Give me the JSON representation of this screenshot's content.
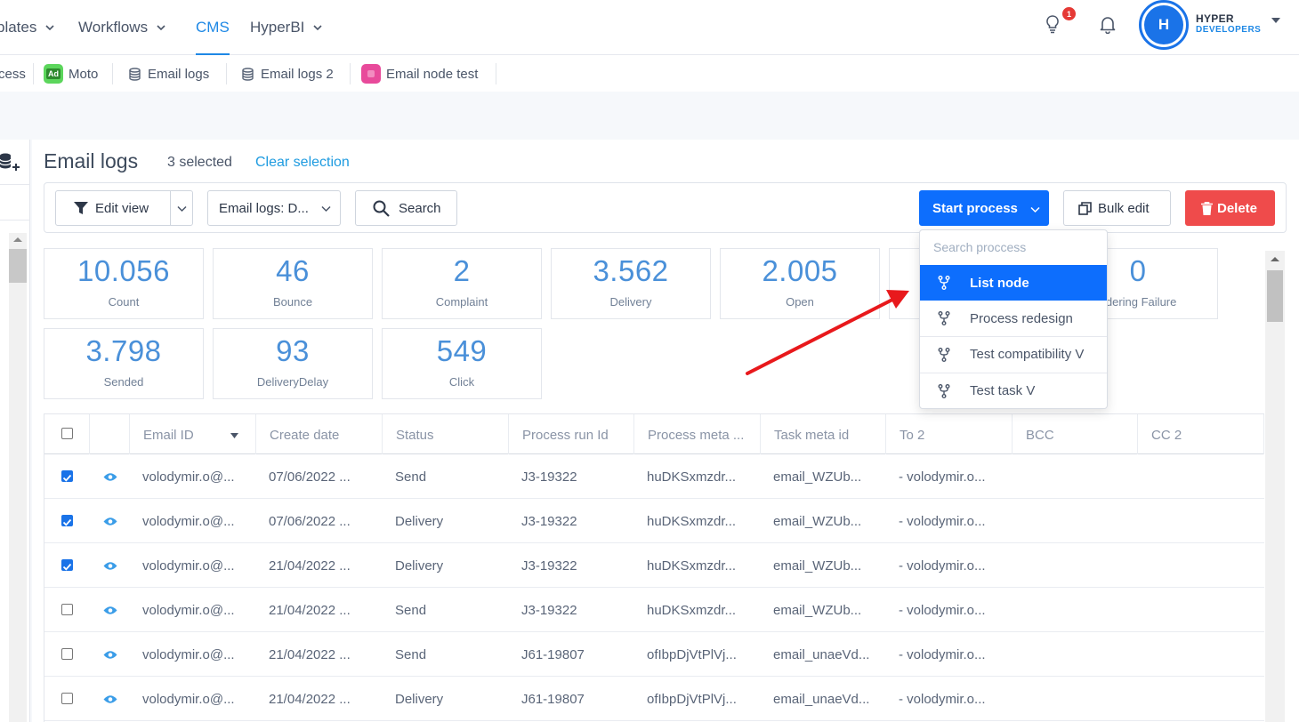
{
  "nav": {
    "items": [
      {
        "label": "plates",
        "has_caret": true
      },
      {
        "label": "Workflows",
        "has_caret": true
      },
      {
        "label": "CMS",
        "has_caret": false,
        "active": true
      },
      {
        "label": "HyperBI",
        "has_caret": true
      }
    ],
    "notification_count": "1",
    "user": {
      "initial": "H",
      "name": "HYPER",
      "org": "DEVELOPERS"
    }
  },
  "tabs": [
    {
      "label": "cess"
    },
    {
      "label": "Moto",
      "badge": "Ad",
      "badge_color": "#5cd65c"
    },
    {
      "label": "Email logs",
      "icon": "database-icon"
    },
    {
      "label": "Email logs 2",
      "icon": "database-icon"
    },
    {
      "label": "Email node test",
      "badge_color": "#e84a9b"
    }
  ],
  "page": {
    "title": "Email logs",
    "selected": "3 selected",
    "clear": "Clear selection"
  },
  "toolbar": {
    "edit_view": "Edit view",
    "view_select": "Email logs: D...",
    "search": "Search",
    "start_process": "Start process",
    "bulk_edit": "Bulk edit",
    "delete": "Delete"
  },
  "stats": [
    {
      "value": "10.056",
      "label": "Count"
    },
    {
      "value": "46",
      "label": "Bounce"
    },
    {
      "value": "2",
      "label": "Complaint"
    },
    {
      "value": "3.562",
      "label": "Delivery"
    },
    {
      "value": "2.005",
      "label": "Open"
    },
    {
      "value": "",
      "label": ""
    },
    {
      "value": "0",
      "label": "ndering Failure"
    },
    {
      "value": "3.798",
      "label": "Sended"
    },
    {
      "value": "93",
      "label": "DeliveryDelay"
    },
    {
      "value": "549",
      "label": "Click"
    }
  ],
  "dropdown": {
    "search_placeholder": "Search proccess",
    "items": [
      {
        "label": "List node",
        "active": true
      },
      {
        "label": "Process redesign"
      },
      {
        "label": "Test compatibility V"
      },
      {
        "label": "Test task V"
      }
    ]
  },
  "table": {
    "columns": [
      "Email ID",
      "Create date",
      "Status",
      "Process run Id",
      "Process meta ...",
      "Task meta id",
      "To 2",
      "BCC",
      "CC 2"
    ],
    "rows": [
      {
        "checked": true,
        "email": "volodymir.o@...",
        "date": "07/06/2022 ...",
        "status": "Send",
        "run": "J3-19322",
        "meta": "huDKSxmzdr...",
        "task": "email_WZUb...",
        "to": "- volodymir.o..."
      },
      {
        "checked": true,
        "email": "volodymir.o@...",
        "date": "07/06/2022 ...",
        "status": "Delivery",
        "run": "J3-19322",
        "meta": "huDKSxmzdr...",
        "task": "email_WZUb...",
        "to": "- volodymir.o..."
      },
      {
        "checked": true,
        "email": "volodymir.o@...",
        "date": "21/04/2022 ...",
        "status": "Delivery",
        "run": "J3-19322",
        "meta": "huDKSxmzdr...",
        "task": "email_WZUb...",
        "to": "- volodymir.o..."
      },
      {
        "checked": false,
        "email": "volodymir.o@...",
        "date": "21/04/2022 ...",
        "status": "Send",
        "run": "J3-19322",
        "meta": "huDKSxmzdr...",
        "task": "email_WZUb...",
        "to": "- volodymir.o..."
      },
      {
        "checked": false,
        "email": "volodymir.o@...",
        "date": "21/04/2022 ...",
        "status": "Send",
        "run": "J61-19807",
        "meta": "ofIbpDjVtPlVj...",
        "task": "email_unaeVd...",
        "to": "- volodymir.o..."
      },
      {
        "checked": false,
        "email": "volodymir.o@...",
        "date": "21/04/2022 ...",
        "status": "Delivery",
        "run": "J61-19807",
        "meta": "ofIbpDjVtPlVj...",
        "task": "email_unaeVd...",
        "to": "- volodymir.o..."
      }
    ]
  },
  "colors": {
    "accent": "#1e88e5",
    "primary": "#0d6efd",
    "danger": "#ef4b4b",
    "annotation": "#e8191c"
  }
}
